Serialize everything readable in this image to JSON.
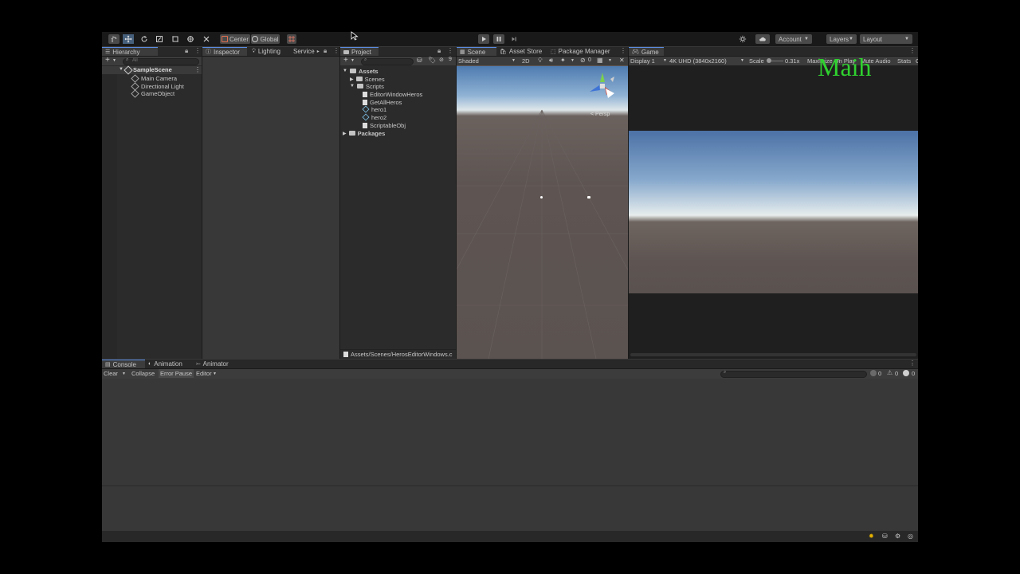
{
  "toolbar": {
    "center_label": "Center",
    "global_label": "Global",
    "account_label": "Account",
    "layers_label": "Layers",
    "layout_label": "Layout"
  },
  "hierarchy": {
    "tab": "Hierarchy",
    "search_placeholder": "All",
    "scene": "SampleScene",
    "items": [
      "Main Camera",
      "Directional Light",
      "GameObject"
    ]
  },
  "inspector_tabs": {
    "inspector": "Inspector",
    "lighting": "Lighting",
    "services": "Service"
  },
  "project": {
    "tab": "Project",
    "hidden_count": "9",
    "assets": "Assets",
    "scenes": "Scenes",
    "scripts": "Scripts",
    "files": [
      "EditorWindowHeros",
      "GetAllHeros",
      "hero1",
      "hero2",
      "ScriptableObj"
    ],
    "packages": "Packages",
    "status_path": "Assets/Scenes/HerosEditorWindows.c"
  },
  "scene": {
    "tab_scene": "Scene",
    "tab_asset_store": "Asset Store",
    "tab_package_manager": "Package Manager",
    "shading": "Shaded",
    "mode_2d": "2D",
    "gizmo_count": "0",
    "persp": "< Persp"
  },
  "game": {
    "tab": "Game",
    "display": "Display 1",
    "resolution": "4K UHD (3840x2160)",
    "scale_label": "Scale",
    "scale_value": "0.31x",
    "maximize": "Maximize On Play",
    "mute": "Mute Audio",
    "stats": "Stats",
    "gizmos": "G"
  },
  "console": {
    "tab_console": "Console",
    "tab_animation": "Animation",
    "tab_animator": "Animator",
    "clear": "Clear",
    "collapse": "Collapse",
    "error_pause": "Error Pause",
    "editor": "Editor",
    "log_count": "0",
    "warn_count": "0",
    "error_count": "0"
  },
  "overlay": {
    "watermark": "Maih",
    "watermark_color": "#2fd12f"
  },
  "colors": {
    "accent": "#46607c",
    "panel": "#2b2b2b",
    "toolbar": "#191919"
  }
}
